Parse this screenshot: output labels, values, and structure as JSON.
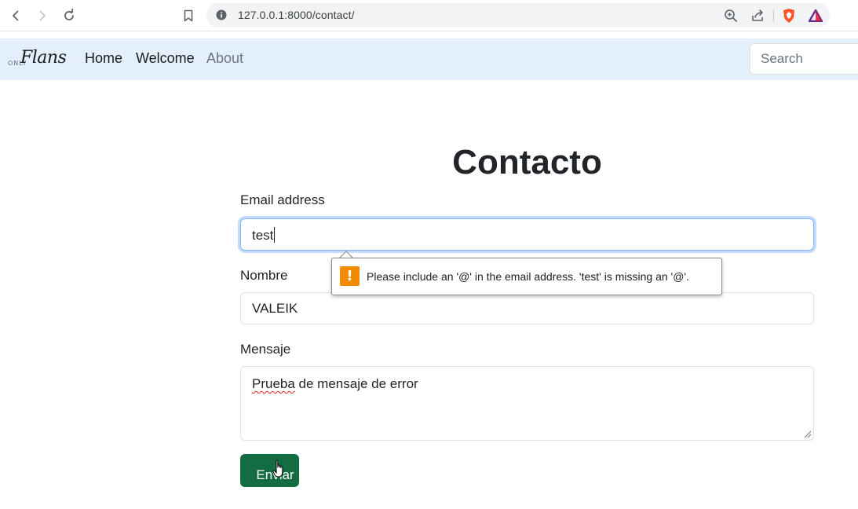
{
  "browser": {
    "url": "127.0.0.1:8000/contact/"
  },
  "navbar": {
    "brand_prefix": "ONLY",
    "brand_name": "Flans",
    "links": [
      {
        "label": "Home"
      },
      {
        "label": "Welcome"
      },
      {
        "label": "About"
      }
    ],
    "search_placeholder": "Search"
  },
  "page": {
    "title": "Contacto"
  },
  "form": {
    "email_label": "Email address",
    "email_value": "test",
    "nombre_label": "Nombre",
    "nombre_value": "VALEIK",
    "mensaje_label": "Mensaje",
    "mensaje_first_word": "Prueba",
    "mensaje_rest": " de mensaje de error",
    "submit_label": "Enviar"
  },
  "validation": {
    "icon": "!",
    "message": "Please include an '@' in the email address. 'test' is missing an '@'."
  },
  "colors": {
    "navbar_bg": "#e3f0fc",
    "submit_bg": "#146c43",
    "warning": "#f28b00",
    "focus_border": "#86b7fe"
  }
}
